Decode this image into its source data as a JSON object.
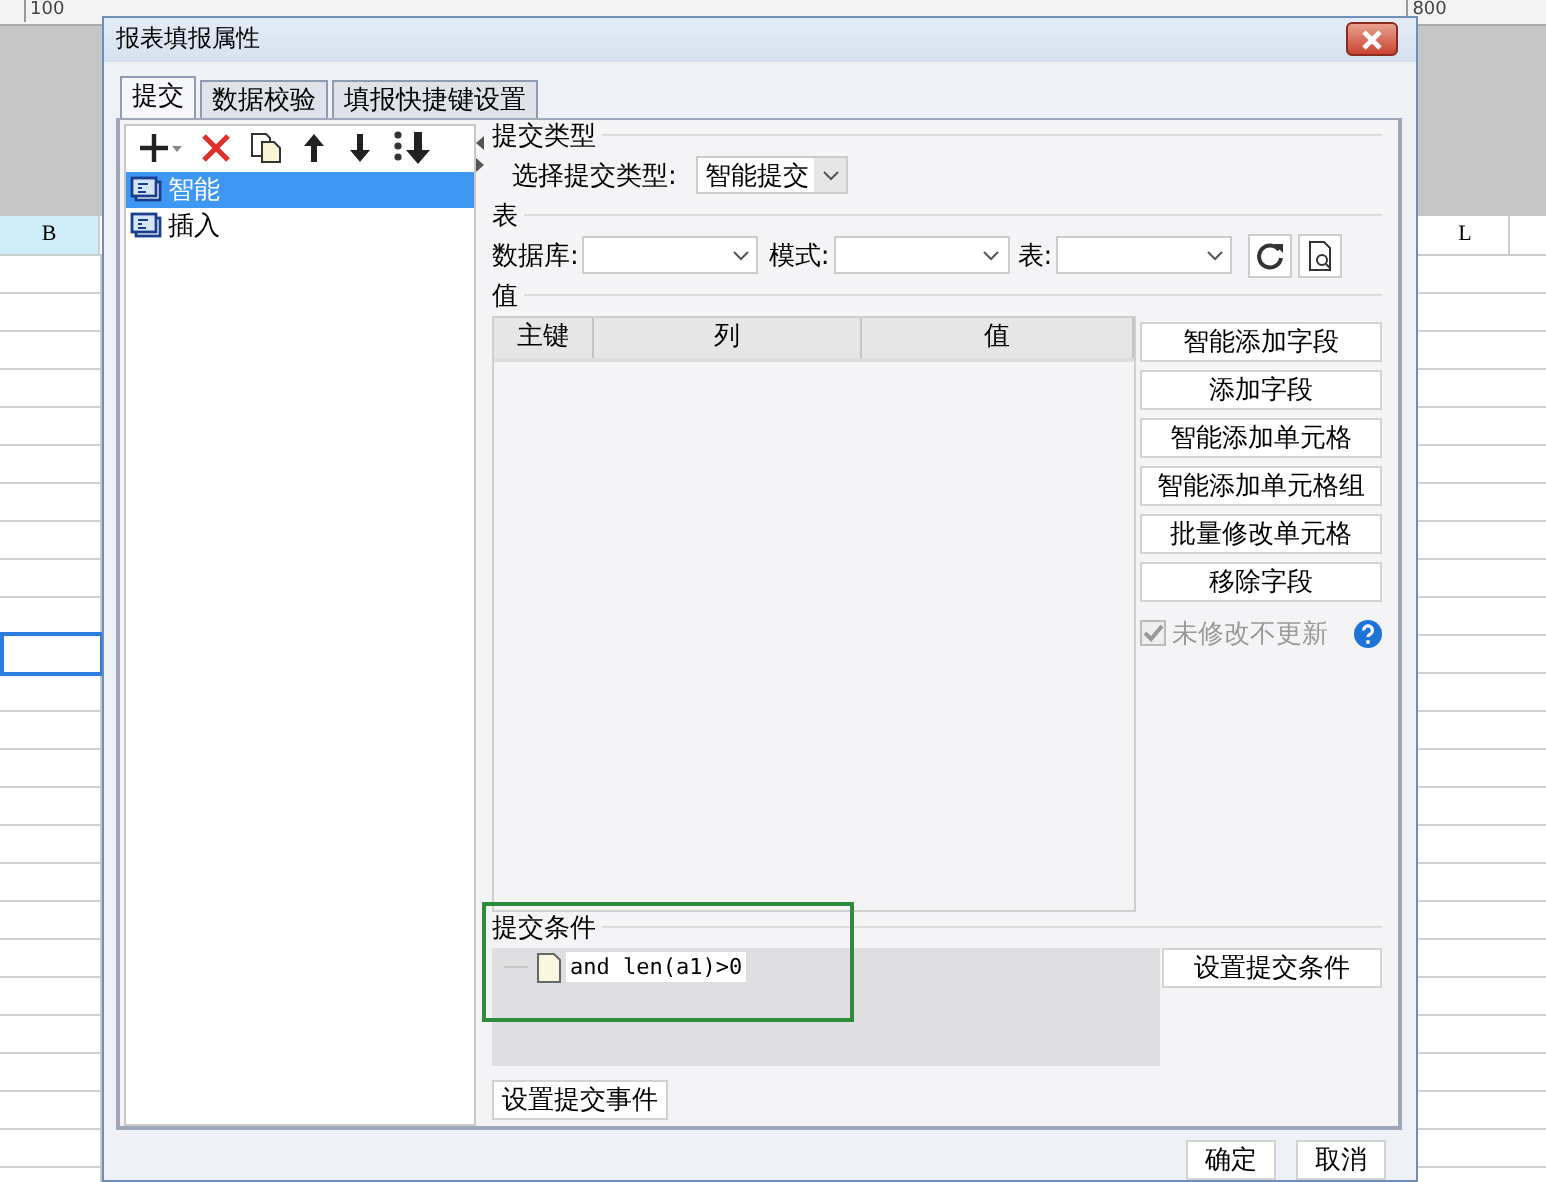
{
  "ruler": {
    "ticks": [
      "100",
      "800"
    ]
  },
  "sheet": {
    "columns": [
      {
        "label": "B",
        "selected": true
      },
      {
        "label": "L",
        "selected": false
      }
    ]
  },
  "dialog": {
    "title": "报表填报属性",
    "tabs": [
      {
        "label": "提交",
        "selected": true
      },
      {
        "label": "数据校验",
        "selected": false
      },
      {
        "label": "填报快捷键设置",
        "selected": false
      }
    ],
    "items": [
      {
        "label": "智能",
        "selected": true
      },
      {
        "label": "插入",
        "selected": false
      }
    ],
    "submit_type": {
      "title": "提交类型",
      "label": "选择提交类型:",
      "value": "智能提交"
    },
    "table_section": {
      "title": "表",
      "fields": [
        {
          "label": "数据库:"
        },
        {
          "label": "模式:"
        },
        {
          "label": "表:"
        }
      ]
    },
    "values": {
      "title": "值",
      "columns": [
        "主键",
        "列",
        "值"
      ],
      "buttons": [
        "智能添加字段",
        "添加字段",
        "智能添加单元格",
        "智能添加单元格组",
        "批量修改单元格",
        "移除字段"
      ],
      "option": {
        "label": "未修改不更新",
        "checked": true,
        "disabled": true
      }
    },
    "condition": {
      "title": "提交条件",
      "items": [
        "and len(a1)>0"
      ],
      "button": "设置提交条件"
    },
    "event_button": "设置提交事件",
    "footer_buttons": [
      "确定",
      "取消"
    ]
  }
}
